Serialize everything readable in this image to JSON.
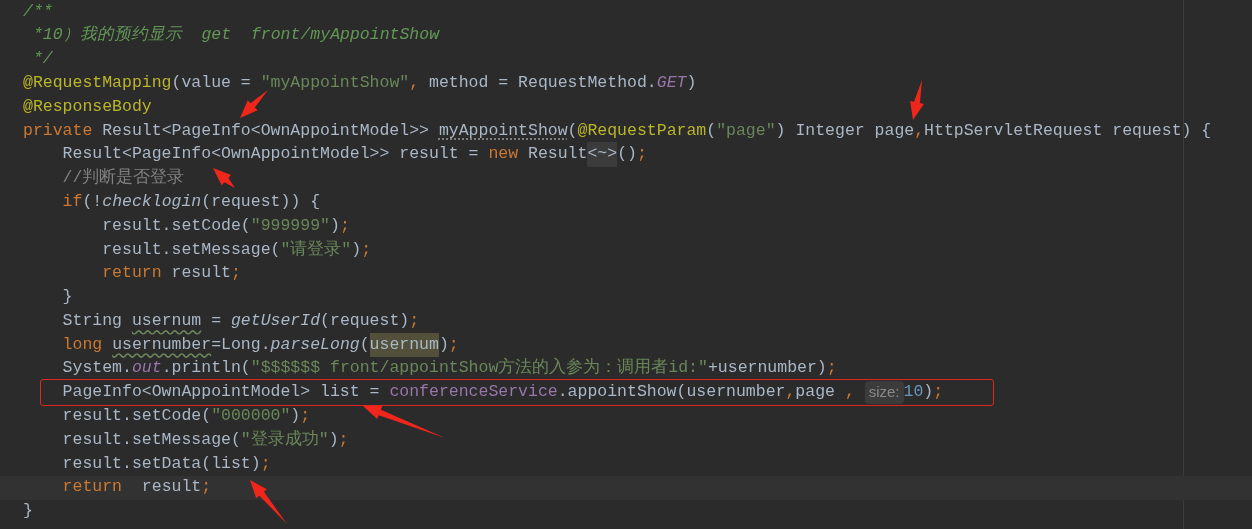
{
  "editor": {
    "lines": [
      {
        "current": false,
        "boxed": false,
        "tokens": [
          {
            "kind": "comment",
            "text": "/**"
          }
        ]
      },
      {
        "current": false,
        "boxed": false,
        "tokens": [
          {
            "kind": "comment",
            "text": " *10）我的预约显示  get  front/myAppointShow"
          }
        ]
      },
      {
        "current": false,
        "boxed": false,
        "tokens": [
          {
            "kind": "comment",
            "text": " */"
          }
        ]
      },
      {
        "current": false,
        "boxed": false,
        "tokens": [
          {
            "kind": "annotation",
            "text": "@RequestMapping"
          },
          {
            "kind": "plain",
            "text": "(value = "
          },
          {
            "kind": "string",
            "text": "\"myAppointShow\""
          },
          {
            "kind": "keyword",
            "text": ", "
          },
          {
            "kind": "plain",
            "text": "method = RequestMethod."
          },
          {
            "kind": "static-field",
            "text": "GET"
          },
          {
            "kind": "plain",
            "text": ")"
          }
        ]
      },
      {
        "current": false,
        "boxed": false,
        "tokens": [
          {
            "kind": "annotation",
            "text": "@ResponseBody"
          }
        ]
      },
      {
        "current": false,
        "boxed": false,
        "tokens": [
          {
            "kind": "keyword",
            "text": "private "
          },
          {
            "kind": "plain",
            "text": "Result<PageInfo<OwnAppointModel>> "
          },
          {
            "kind": "unused",
            "text": "myAppointShow"
          },
          {
            "kind": "plain",
            "text": "("
          },
          {
            "kind": "annotation",
            "text": "@RequestParam"
          },
          {
            "kind": "plain",
            "text": "("
          },
          {
            "kind": "string",
            "text": "\"page\""
          },
          {
            "kind": "plain",
            "text": ") Integer page"
          },
          {
            "kind": "keyword",
            "text": ","
          },
          {
            "kind": "plain",
            "text": "HttpServletRequest request) {"
          }
        ]
      },
      {
        "current": false,
        "boxed": false,
        "tokens": [
          {
            "kind": "plain",
            "text": "    Result<PageInfo<OwnAppointModel>> result = "
          },
          {
            "kind": "keyword",
            "text": "new "
          },
          {
            "kind": "plain",
            "text": "Result"
          },
          {
            "kind": "fold",
            "text": "<~>"
          },
          {
            "kind": "plain",
            "text": "()"
          },
          {
            "kind": "keyword",
            "text": ";"
          }
        ]
      },
      {
        "current": false,
        "boxed": false,
        "tokens": [
          {
            "kind": "line-comment",
            "text": "    //判断是否登录"
          }
        ]
      },
      {
        "current": false,
        "boxed": false,
        "tokens": [
          {
            "kind": "keyword",
            "text": "    if"
          },
          {
            "kind": "plain",
            "text": "(!"
          },
          {
            "kind": "static-call",
            "text": "checklogin"
          },
          {
            "kind": "plain",
            "text": "(request)) {"
          }
        ]
      },
      {
        "current": false,
        "boxed": false,
        "tokens": [
          {
            "kind": "plain",
            "text": "        result.setCode("
          },
          {
            "kind": "string",
            "text": "\"999999\""
          },
          {
            "kind": "plain",
            "text": ")"
          },
          {
            "kind": "keyword",
            "text": ";"
          }
        ]
      },
      {
        "current": false,
        "boxed": false,
        "tokens": [
          {
            "kind": "plain",
            "text": "        result.setMessage("
          },
          {
            "kind": "string",
            "text": "\"请登录\""
          },
          {
            "kind": "plain",
            "text": ")"
          },
          {
            "kind": "keyword",
            "text": ";"
          }
        ]
      },
      {
        "current": false,
        "boxed": false,
        "tokens": [
          {
            "kind": "keyword",
            "text": "        return "
          },
          {
            "kind": "plain",
            "text": "result"
          },
          {
            "kind": "keyword",
            "text": ";"
          }
        ]
      },
      {
        "current": false,
        "boxed": false,
        "tokens": [
          {
            "kind": "plain",
            "text": "    }"
          }
        ]
      },
      {
        "current": false,
        "boxed": false,
        "tokens": [
          {
            "kind": "plain",
            "text": "    String "
          },
          {
            "kind": "warn",
            "text": "usernum"
          },
          {
            "kind": "plain",
            "text": " = "
          },
          {
            "kind": "static-call",
            "text": "getUserId"
          },
          {
            "kind": "plain",
            "text": "(request)"
          },
          {
            "kind": "keyword",
            "text": ";"
          }
        ]
      },
      {
        "current": false,
        "boxed": false,
        "tokens": [
          {
            "kind": "keyword",
            "text": "    long "
          },
          {
            "kind": "warn",
            "text": "usernumber"
          },
          {
            "kind": "plain",
            "text": "=Long."
          },
          {
            "kind": "static-call",
            "text": "parseLong"
          },
          {
            "kind": "plain",
            "text": "("
          },
          {
            "kind": "highlight",
            "text": "usernum"
          },
          {
            "kind": "plain",
            "text": ")"
          },
          {
            "kind": "keyword",
            "text": ";"
          }
        ]
      },
      {
        "current": false,
        "boxed": false,
        "tokens": [
          {
            "kind": "plain",
            "text": "    System."
          },
          {
            "kind": "static-field",
            "text": "out"
          },
          {
            "kind": "plain",
            "text": ".println("
          },
          {
            "kind": "string",
            "text": "\"$$$$$$ front/appointShow方法的入参为：调用者id:\""
          },
          {
            "kind": "plain",
            "text": "+usernumber)"
          },
          {
            "kind": "keyword",
            "text": ";"
          }
        ]
      },
      {
        "current": false,
        "boxed": true,
        "tokens": [
          {
            "kind": "plain",
            "text": "    PageInfo<OwnAppointModel> list = "
          },
          {
            "kind": "field",
            "text": "conferenceService"
          },
          {
            "kind": "plain",
            "text": ".appointShow(usernumber"
          },
          {
            "kind": "keyword",
            "text": ","
          },
          {
            "kind": "plain",
            "text": "page "
          },
          {
            "kind": "keyword",
            "text": ", "
          },
          {
            "kind": "hint",
            "text": "size:"
          },
          {
            "kind": "number",
            "text": "10"
          },
          {
            "kind": "plain",
            "text": ")"
          },
          {
            "kind": "keyword",
            "text": ";"
          }
        ]
      },
      {
        "current": false,
        "boxed": false,
        "tokens": [
          {
            "kind": "plain",
            "text": "    result.setCode("
          },
          {
            "kind": "string",
            "text": "\"000000\""
          },
          {
            "kind": "plain",
            "text": ")"
          },
          {
            "kind": "keyword",
            "text": ";"
          }
        ]
      },
      {
        "current": false,
        "boxed": false,
        "tokens": [
          {
            "kind": "plain",
            "text": "    result.setMessage("
          },
          {
            "kind": "string",
            "text": "\"登录成功\""
          },
          {
            "kind": "plain",
            "text": ")"
          },
          {
            "kind": "keyword",
            "text": ";"
          }
        ]
      },
      {
        "current": false,
        "boxed": false,
        "tokens": [
          {
            "kind": "plain",
            "text": "    result.setData(list)"
          },
          {
            "kind": "keyword",
            "text": ";"
          }
        ]
      },
      {
        "current": true,
        "boxed": false,
        "tokens": [
          {
            "kind": "keyword",
            "text": "    return  "
          },
          {
            "kind": "plain",
            "text": "result"
          },
          {
            "kind": "keyword",
            "text": ";"
          }
        ]
      },
      {
        "current": false,
        "boxed": false,
        "tokens": [
          {
            "kind": "plain",
            "text": "}"
          }
        ]
      }
    ]
  }
}
